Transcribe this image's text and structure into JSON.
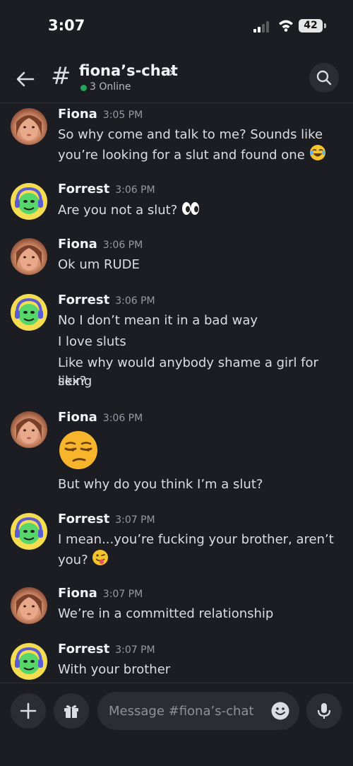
{
  "status_bar": {
    "time": "3:07",
    "battery": "42"
  },
  "header": {
    "channel": "fiona’s-chat",
    "online": "3 Online",
    "hash": "#",
    "chevron": "›"
  },
  "messages": [
    {
      "author": "Fiona",
      "time": "3:05 PM",
      "lines": [
        "So why come and talk to me? Sounds like",
        "you’re looking for a slut and found one"
      ],
      "emoji": "joy"
    },
    {
      "author": "Forrest",
      "time": "3:06 PM",
      "lines": [
        "Are you not a slut?"
      ],
      "emoji": "eyes"
    },
    {
      "author": "Fiona",
      "time": "3:06 PM",
      "lines": [
        "Ok um RUDE"
      ]
    },
    {
      "author": "Forrest",
      "time": "3:06 PM",
      "lines": [
        "No I don’t mean it in a bad way",
        "I love sluts",
        "Like why would anybody shame a girl for liking",
        "sex?"
      ]
    },
    {
      "author": "Fiona",
      "time": "3:06 PM",
      "big_emoji": "unamused",
      "lines": [
        "But why do you think I’m a slut?"
      ]
    },
    {
      "author": "Forrest",
      "time": "3:07 PM",
      "lines": [
        "I mean...you’re fucking your brother, aren’t",
        "you?"
      ],
      "emoji": "winking-tongue"
    },
    {
      "author": "Fiona",
      "time": "3:07 PM",
      "lines": [
        "We’re in a committed relationship"
      ]
    },
    {
      "author": "Forrest",
      "time": "3:07 PM",
      "lines": [
        "With your brother"
      ]
    }
  ],
  "composer": {
    "placeholder": "Message #fiona’s-chat"
  },
  "colors": {
    "background": "#1c1d22",
    "online": "#23a55a",
    "surface": "#2b2d33"
  }
}
